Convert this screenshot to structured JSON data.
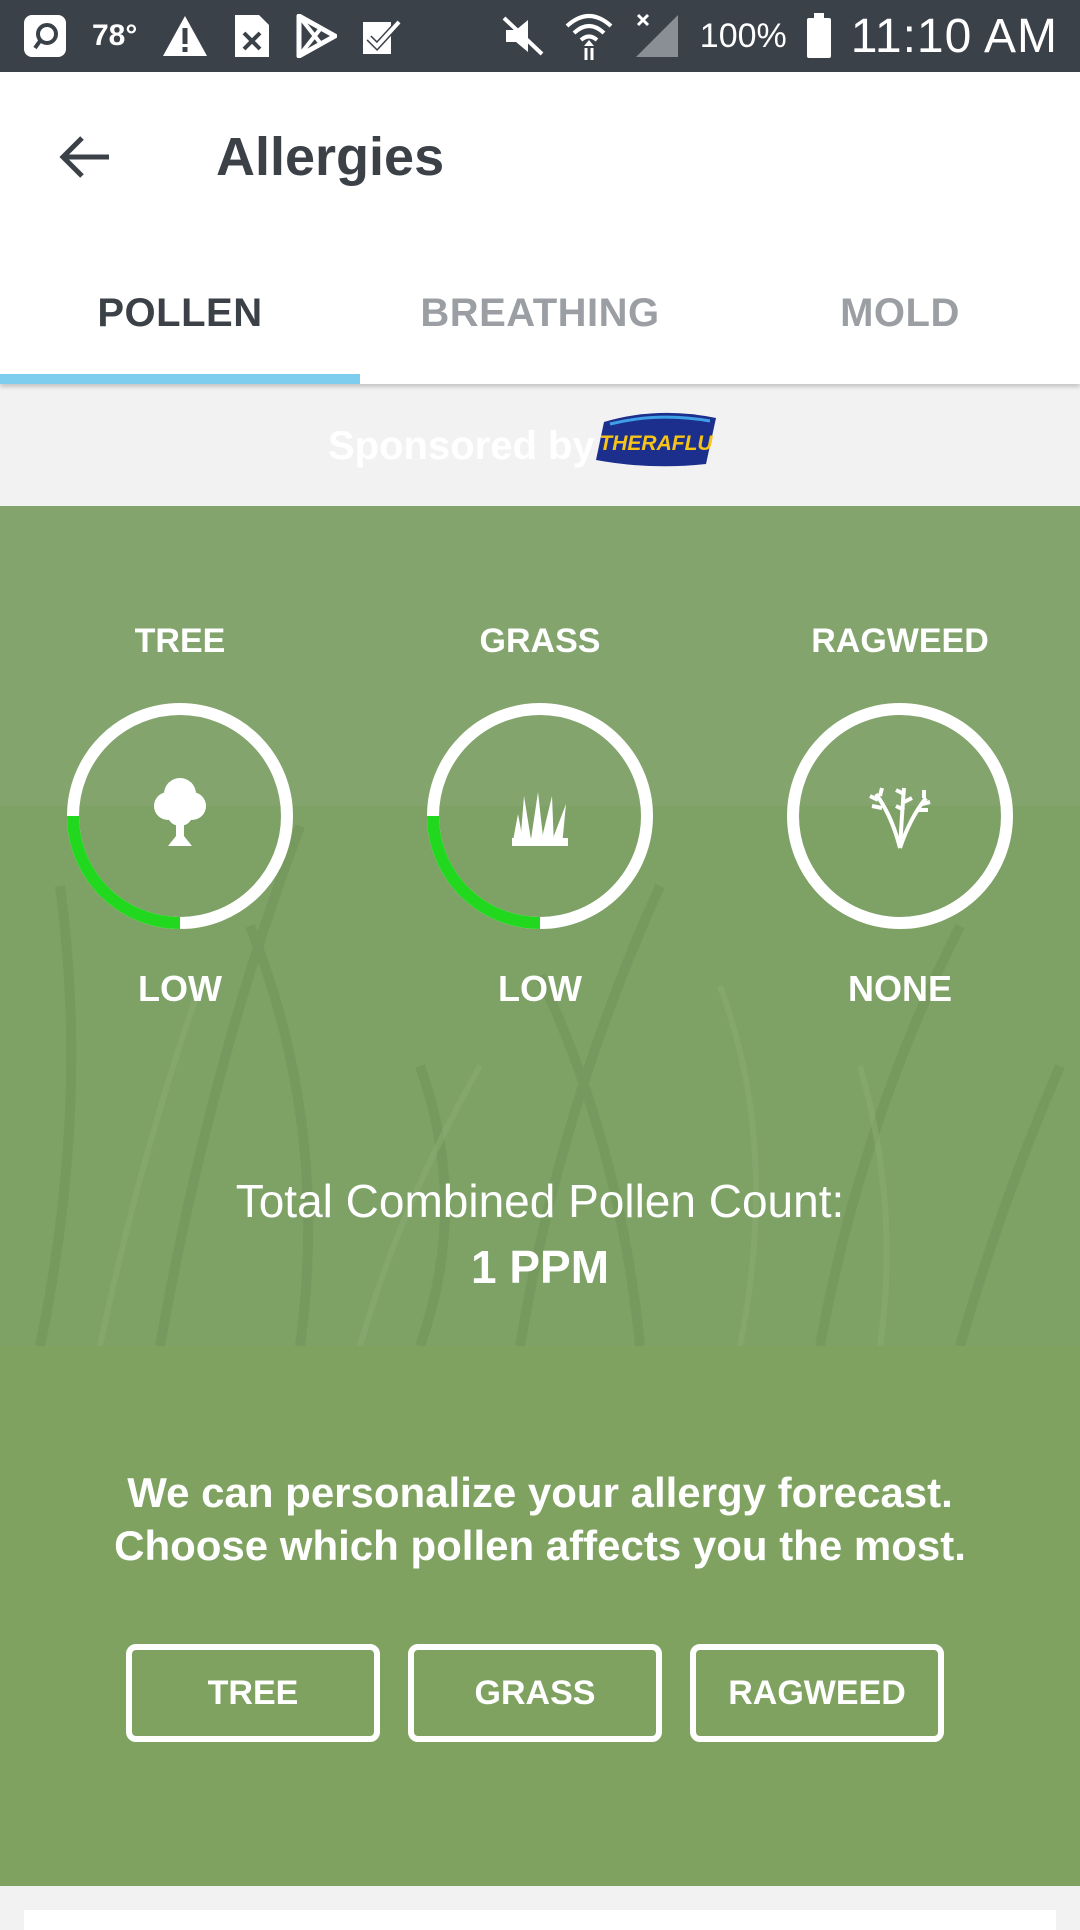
{
  "status_bar": {
    "temperature": "78°",
    "battery": "100%",
    "time": "11:10 AM",
    "icons": [
      "app-icon",
      "alert-icon",
      "close-box-icon",
      "play-store-icon",
      "checkmark-icon",
      "mute-icon",
      "wifi-icon",
      "signal-icon",
      "battery-icon"
    ]
  },
  "header": {
    "title": "Allergies"
  },
  "tabs": [
    {
      "label": "POLLEN",
      "active": true
    },
    {
      "label": "BREATHING",
      "active": false
    },
    {
      "label": "MOLD",
      "active": false
    }
  ],
  "sponsor": {
    "text": "Sponsored by",
    "brand": "THERAFLU"
  },
  "pollen": {
    "types": [
      {
        "name": "TREE",
        "level": "LOW",
        "icon": "tree-icon",
        "fill": 0.25
      },
      {
        "name": "GRASS",
        "level": "LOW",
        "icon": "grass-icon",
        "fill": 0.25
      },
      {
        "name": "RAGWEED",
        "level": "NONE",
        "icon": "ragweed-icon",
        "fill": 0
      }
    ],
    "total_label": "Total Combined Pollen Count:",
    "total_value": "1 PPM",
    "ring_color": "#ffffff",
    "level_color": "#22d81f"
  },
  "personalize": {
    "line1": "We can personalize your allergy forecast.",
    "line2": "Choose which pollen affects you the most.",
    "buttons": [
      "TREE",
      "GRASS",
      "RAGWEED"
    ]
  }
}
